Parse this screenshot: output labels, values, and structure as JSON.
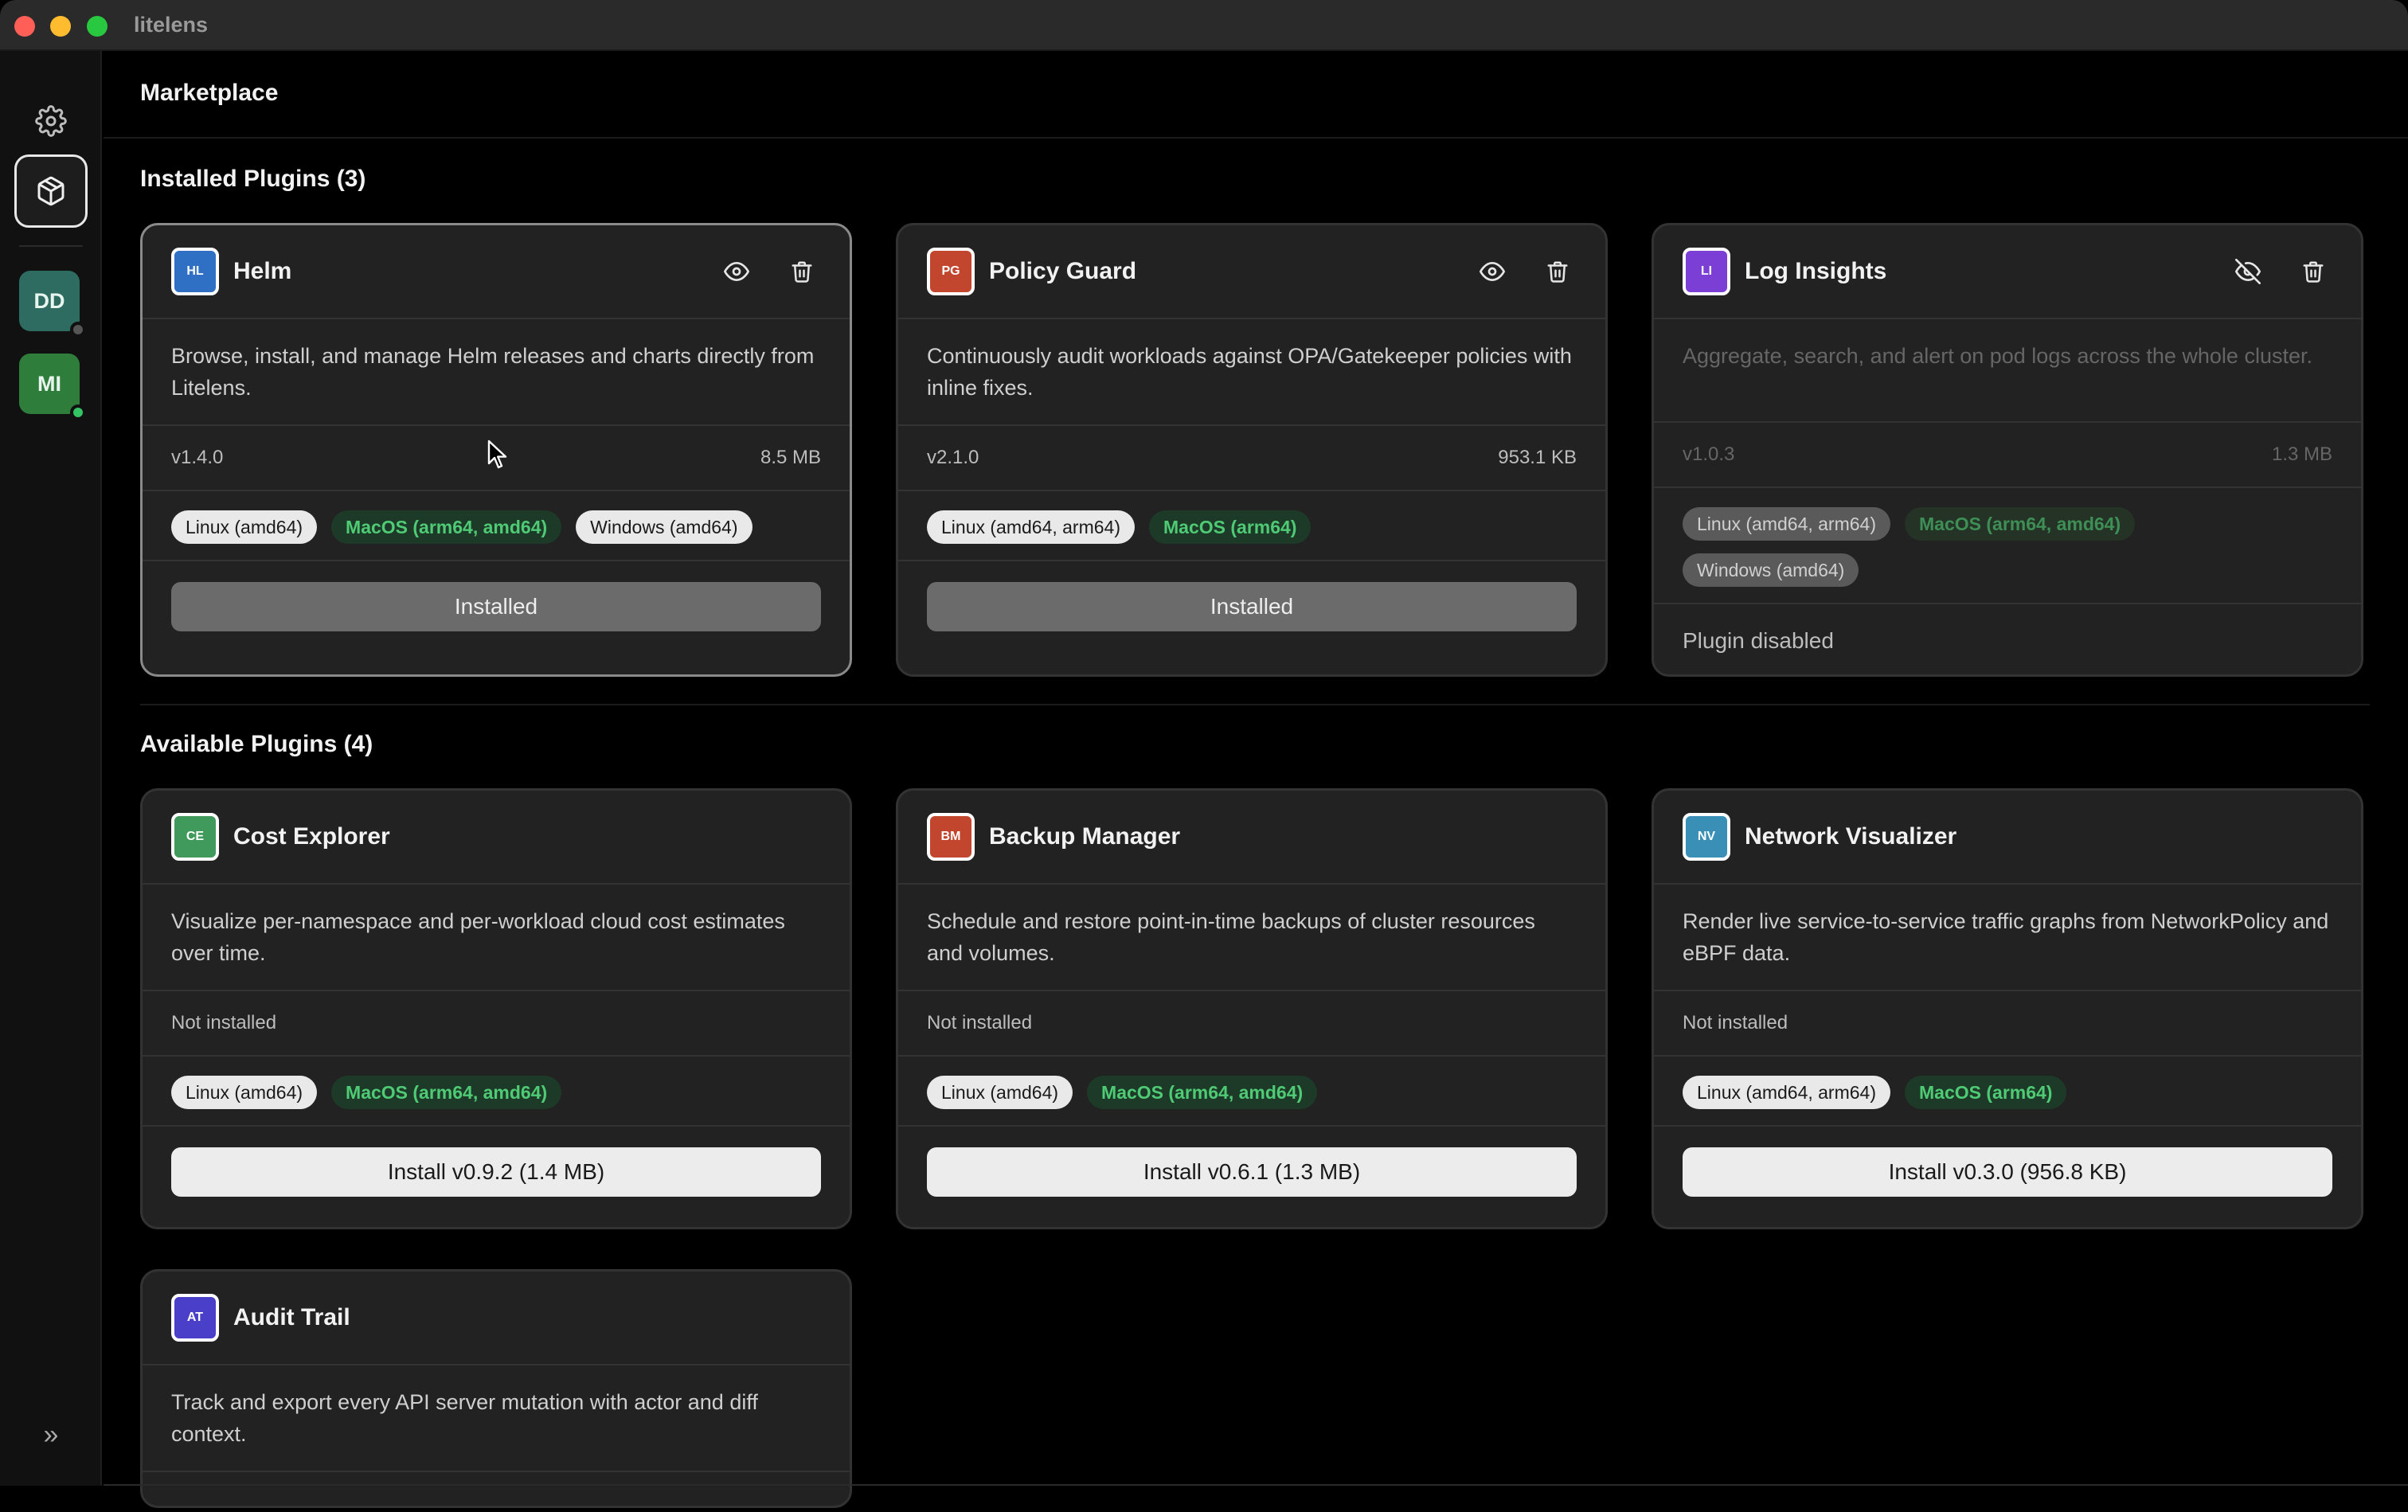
{
  "app": {
    "title": "litelens"
  },
  "sidebar": {
    "clusters": [
      {
        "initials": "DD",
        "color": "#2e6b60",
        "status_color": "#555555"
      },
      {
        "initials": "MI",
        "color": "#2f7d3a",
        "status_color": "#33c463"
      }
    ]
  },
  "page": {
    "title": "Marketplace"
  },
  "installed": {
    "title": "Installed Plugins (3)",
    "plugins": [
      {
        "abbr": "HL",
        "logo_color": "#2f6fc4",
        "name": "Helm",
        "description": "Browse, install, and manage Helm releases and charts directly from Litelens.",
        "version": "v1.4.0",
        "size": "8.5 MB",
        "tags": [
          {
            "label": "Linux (amd64)",
            "kind": "gray"
          },
          {
            "label": "MacOS (arm64, amd64)",
            "kind": "green"
          },
          {
            "label": "Windows (amd64)",
            "kind": "gray"
          }
        ],
        "button": "Installed"
      },
      {
        "abbr": "PG",
        "logo_color": "#c2452d",
        "name": "Policy Guard",
        "description": "Continuously audit workloads against OPA/Gatekeeper policies with inline fixes.",
        "version": "v2.1.0",
        "size": "953.1 KB",
        "tags": [
          {
            "label": "Linux (amd64, arm64)",
            "kind": "gray"
          },
          {
            "label": "MacOS (arm64)",
            "kind": "green"
          }
        ],
        "button": "Installed"
      },
      {
        "abbr": "LI",
        "logo_color": "#7b3fd6",
        "name": "Log Insights",
        "description": "Aggregate, search, and alert on pod logs across the whole cluster.",
        "version": "v1.0.3",
        "size": "1.3 MB",
        "tags": [
          {
            "label": "Linux (amd64, arm64)",
            "kind": "gray"
          },
          {
            "label": "MacOS (arm64, amd64)",
            "kind": "green"
          },
          {
            "label": "Windows (amd64)",
            "kind": "gray"
          }
        ],
        "status_note": "Plugin disabled"
      }
    ]
  },
  "available": {
    "title": "Available Plugins (4)",
    "plugins": [
      {
        "abbr": "CE",
        "logo_color": "#3f9a5c",
        "name": "Cost Explorer",
        "description": "Visualize per-namespace and per-workload cloud cost estimates over time.",
        "status": "Not installed",
        "tags": [
          {
            "label": "Linux (amd64)",
            "kind": "gray"
          },
          {
            "label": "MacOS (arm64, amd64)",
            "kind": "green"
          }
        ],
        "button": "Install v0.9.2 (1.4 MB)"
      },
      {
        "abbr": "BM",
        "logo_color": "#c2452d",
        "name": "Backup Manager",
        "description": "Schedule and restore point-in-time backups of cluster resources and volumes.",
        "status": "Not installed",
        "tags": [
          {
            "label": "Linux (amd64)",
            "kind": "gray"
          },
          {
            "label": "MacOS (arm64, amd64)",
            "kind": "green"
          }
        ],
        "button": "Install v0.6.1 (1.3 MB)"
      },
      {
        "abbr": "NV",
        "logo_color": "#3a8fb7",
        "name": "Network Visualizer",
        "description": "Render live service-to-service traffic graphs from NetworkPolicy and eBPF data.",
        "status": "Not installed",
        "tags": [
          {
            "label": "Linux (amd64, arm64)",
            "kind": "gray"
          },
          {
            "label": "MacOS (arm64)",
            "kind": "green"
          }
        ],
        "button": "Install v0.3.0 (956.8 KB)"
      },
      {
        "abbr": "AT",
        "logo_color": "#4a3fc8",
        "name": "Audit Trail",
        "description": "Track and export every API server mutation with actor and diff context."
      }
    ]
  }
}
